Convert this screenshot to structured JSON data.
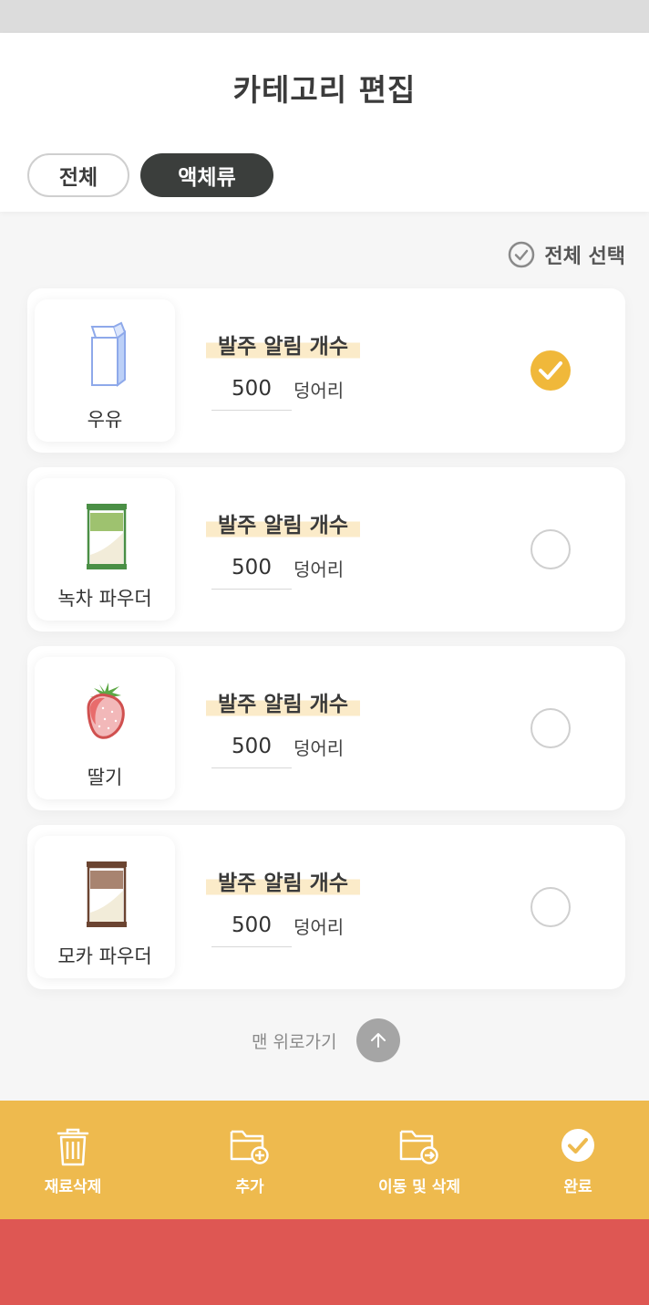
{
  "header": {
    "title": "카테고리 편집"
  },
  "tabs": [
    {
      "label": "전체",
      "active": false
    },
    {
      "label": "액체류",
      "active": true
    }
  ],
  "select_all": {
    "label": "전체 선택"
  },
  "items": [
    {
      "name": "우유",
      "alert_label": "발주 알림 개수",
      "quantity": "500",
      "unit": "덩어리",
      "checked": true,
      "icon": "milk-carton-icon"
    },
    {
      "name": "녹차 파우더",
      "alert_label": "발주 알림 개수",
      "quantity": "500",
      "unit": "덩어리",
      "checked": false,
      "icon": "green-tea-powder-bag-icon"
    },
    {
      "name": "딸기",
      "alert_label": "발주 알림 개수",
      "quantity": "500",
      "unit": "덩어리",
      "checked": false,
      "icon": "strawberry-icon"
    },
    {
      "name": "모카 파우더",
      "alert_label": "발주 알림 개수",
      "quantity": "500",
      "unit": "덩어리",
      "checked": false,
      "icon": "mocha-powder-bag-icon"
    }
  ],
  "scroll_top": {
    "label": "맨 위로가기"
  },
  "toolbar": {
    "delete_label": "재료삭제",
    "add_label": "추가",
    "move_delete_label": "이동 및 삭제",
    "done_label": "완료"
  },
  "colors": {
    "accent": "#eeba4e",
    "check_on": "#f0b83a",
    "chip_active": "#3b3e3c",
    "bottom_red": "#de5753"
  }
}
